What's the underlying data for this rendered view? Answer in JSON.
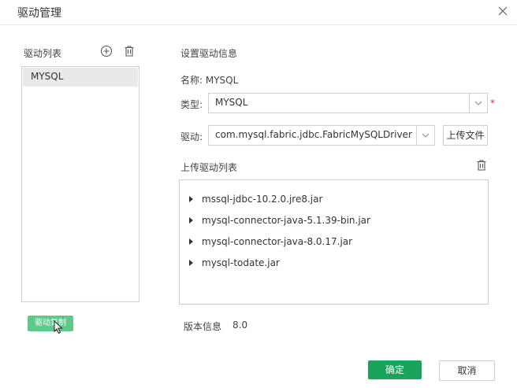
{
  "dialog": {
    "title": "驱动管理",
    "close_icon": "close-icon"
  },
  "left_panel": {
    "title": "驱动列表",
    "add_icon": "plus-circle-icon",
    "delete_icon": "trash-icon",
    "items": [
      {
        "label": "MYSQL",
        "selected": true
      }
    ],
    "copy_button": "驱动复制"
  },
  "right_panel": {
    "section_title": "设置驱动信息",
    "name_label": "名称:",
    "name_value": "MYSQL",
    "type_label": "类型:",
    "type_value": "MYSQL",
    "required_mark": "*",
    "driver_label": "驱动:",
    "driver_value": "com.mysql.fabric.jdbc.FabricMySQLDriver",
    "upload_button": "上传文件",
    "upload_list_title": "上传驱动列表",
    "files": [
      "mssql-jdbc-10.2.0.jre8.jar",
      "mysql-connector-java-5.1.39-bin.jar",
      "mysql-connector-java-8.0.17.jar",
      "mysql-todate.jar"
    ],
    "version_label": "版本信息",
    "version_value": "8.0"
  },
  "footer": {
    "ok": "确定",
    "cancel": "取消"
  },
  "colors": {
    "primary": "#1aa35a",
    "copy_button": "#5ec98a",
    "required": "#e0303a",
    "selected_item": "#e9e9e9",
    "border": "#cfcfcf"
  }
}
